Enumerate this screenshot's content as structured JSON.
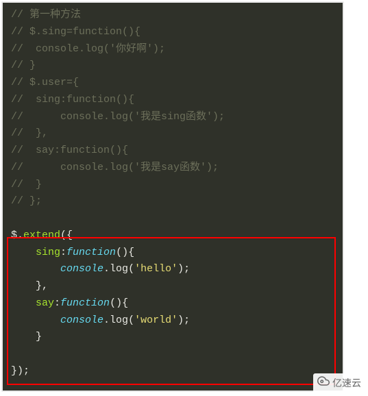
{
  "code": {
    "c1": "// 第一种方法",
    "c2": "// $.sing=function(){",
    "c3": "//  console.log('你好啊');",
    "c4": "// }",
    "blank1": "",
    "c5": "// $.user={",
    "c6": "//  sing:function(){",
    "c7": "//      console.log('我是sing函数');",
    "c8": "//  },",
    "c9": "//  say:function(){",
    "c10": "//      console.log('我是say函数');",
    "c11": "//  }",
    "c12": "// };"
  },
  "highlight": {
    "dollar": "$",
    "dot1": ".",
    "extend": "extend",
    "open": "({",
    "indent1": "    ",
    "indent2": "        ",
    "sing": "sing",
    "colon": ":",
    "function": "function",
    "parenBrace": "(){",
    "console": "console",
    "dot2": ".",
    "log": "log",
    "openP": "(",
    "hello": "'hello'",
    "closePsemi": ");",
    "closeBraceComma": "},",
    "say": "say",
    "world": "'world'",
    "closeBrace": "}",
    "closeAll": "});"
  },
  "watermark": {
    "text": "亿速云"
  }
}
